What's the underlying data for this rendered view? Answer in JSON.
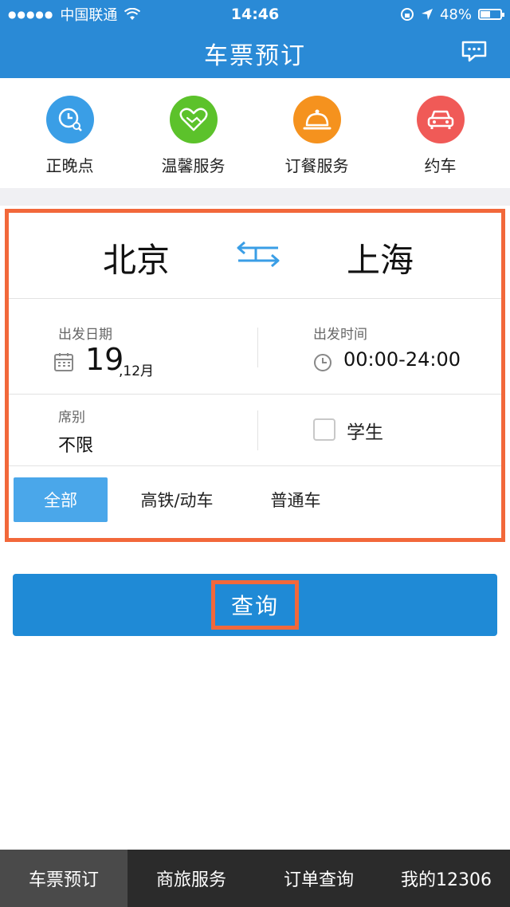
{
  "status_bar": {
    "signal": "●●●●●",
    "carrier": "中国联通",
    "time": "14:46",
    "battery": "48%"
  },
  "header": {
    "title": "车票预订"
  },
  "quick_services": [
    {
      "label": "正晚点",
      "icon": "clock-search-icon",
      "color": "#3a9ee6"
    },
    {
      "label": "温馨服务",
      "icon": "handshake-heart-icon",
      "color": "#5cc22b"
    },
    {
      "label": "订餐服务",
      "icon": "food-cloche-icon",
      "color": "#f5921e"
    },
    {
      "label": "约车",
      "icon": "car-icon",
      "color": "#f05a57"
    }
  ],
  "booking": {
    "from_city": "北京",
    "to_city": "上海",
    "date_label": "出发日期",
    "date_day": "19",
    "date_month": ",12月",
    "time_label": "出发时间",
    "time_value": "00:00-24:00",
    "seat_label": "席别",
    "seat_value": "不限",
    "student_label": "学生",
    "student_checked": false,
    "tabs": [
      {
        "label": "全部",
        "active": true
      },
      {
        "label": "高铁/动车",
        "active": false
      },
      {
        "label": "普通车",
        "active": false
      }
    ]
  },
  "search": {
    "label": "查询"
  },
  "bottom_nav": [
    {
      "label": "车票预订",
      "active": true
    },
    {
      "label": "商旅服务",
      "active": false
    },
    {
      "label": "订单查询",
      "active": false
    },
    {
      "label": "我的12306",
      "active": false
    }
  ],
  "colors": {
    "primary": "#2a8ad6",
    "highlight": "#f2683a",
    "tab_active": "#4aa7ea",
    "nav_bg": "#2b2b2b"
  }
}
